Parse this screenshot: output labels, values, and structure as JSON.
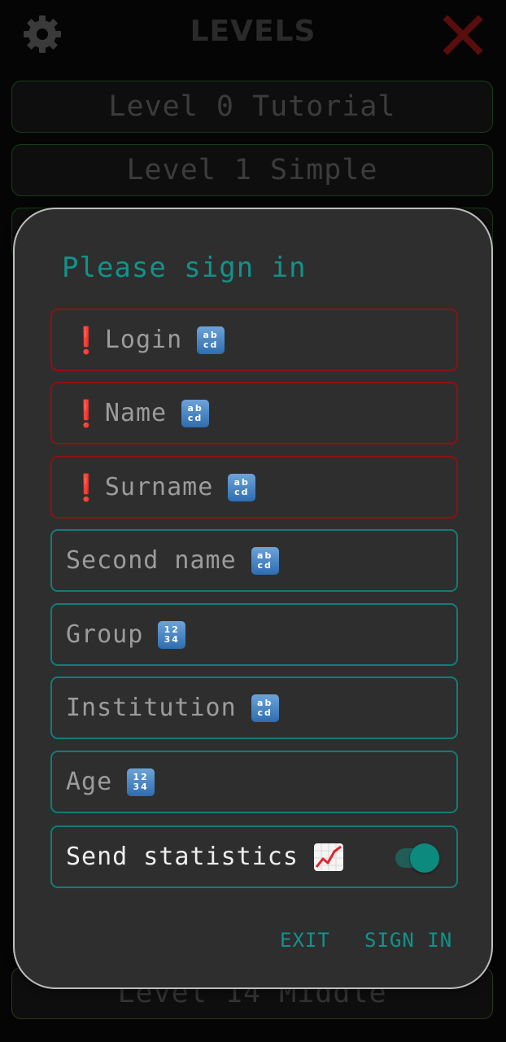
{
  "header": {
    "title": "LEVELS",
    "settings_icon": "gear-icon",
    "close_icon": "close-icon"
  },
  "levels": [
    {
      "label": "Level 0 Tutorial"
    },
    {
      "label": "Level 1 Simple"
    }
  ],
  "bottom_level": {
    "label": "Level 14 Middle"
  },
  "dialog": {
    "title": "Please sign in",
    "fields": [
      {
        "label": "Login",
        "required": true,
        "icon": "abcd",
        "glyph": "ab cd"
      },
      {
        "label": "Name",
        "required": true,
        "icon": "abcd",
        "glyph": "ab cd"
      },
      {
        "label": "Surname",
        "required": true,
        "icon": "abcd",
        "glyph": "ab cd"
      },
      {
        "label": "Second name",
        "required": false,
        "icon": "abcd",
        "glyph": "ab cd"
      },
      {
        "label": "Group",
        "required": false,
        "icon": "1234",
        "glyph": "12 34"
      },
      {
        "label": "Institution",
        "required": false,
        "icon": "abcd",
        "glyph": "ab cd"
      },
      {
        "label": "Age",
        "required": false,
        "icon": "1234",
        "glyph": "12 34"
      }
    ],
    "required_mark": "❗",
    "statistics": {
      "label": "Send statistics",
      "icon": "chart-increasing-icon",
      "enabled": true
    },
    "exit_label": "EXIT",
    "signin_label": "SIGN IN"
  },
  "colors": {
    "accent": "#11938a",
    "error_border": "#8c1212",
    "field_border": "#137c78",
    "dialog_bg": "#2e2e2e",
    "page_bg": "#050505"
  }
}
